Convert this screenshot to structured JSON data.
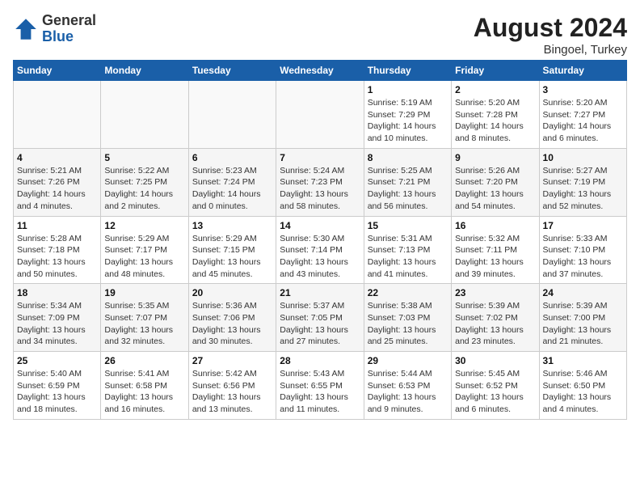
{
  "header": {
    "logo": {
      "general": "General",
      "blue": "Blue"
    },
    "title": "August 2024",
    "location": "Bingoel, Turkey"
  },
  "days_of_week": [
    "Sunday",
    "Monday",
    "Tuesday",
    "Wednesday",
    "Thursday",
    "Friday",
    "Saturday"
  ],
  "weeks": [
    [
      {
        "day": "",
        "info": ""
      },
      {
        "day": "",
        "info": ""
      },
      {
        "day": "",
        "info": ""
      },
      {
        "day": "",
        "info": ""
      },
      {
        "day": "1",
        "info": "Sunrise: 5:19 AM\nSunset: 7:29 PM\nDaylight: 14 hours\nand 10 minutes."
      },
      {
        "day": "2",
        "info": "Sunrise: 5:20 AM\nSunset: 7:28 PM\nDaylight: 14 hours\nand 8 minutes."
      },
      {
        "day": "3",
        "info": "Sunrise: 5:20 AM\nSunset: 7:27 PM\nDaylight: 14 hours\nand 6 minutes."
      }
    ],
    [
      {
        "day": "4",
        "info": "Sunrise: 5:21 AM\nSunset: 7:26 PM\nDaylight: 14 hours\nand 4 minutes."
      },
      {
        "day": "5",
        "info": "Sunrise: 5:22 AM\nSunset: 7:25 PM\nDaylight: 14 hours\nand 2 minutes."
      },
      {
        "day": "6",
        "info": "Sunrise: 5:23 AM\nSunset: 7:24 PM\nDaylight: 14 hours\nand 0 minutes."
      },
      {
        "day": "7",
        "info": "Sunrise: 5:24 AM\nSunset: 7:23 PM\nDaylight: 13 hours\nand 58 minutes."
      },
      {
        "day": "8",
        "info": "Sunrise: 5:25 AM\nSunset: 7:21 PM\nDaylight: 13 hours\nand 56 minutes."
      },
      {
        "day": "9",
        "info": "Sunrise: 5:26 AM\nSunset: 7:20 PM\nDaylight: 13 hours\nand 54 minutes."
      },
      {
        "day": "10",
        "info": "Sunrise: 5:27 AM\nSunset: 7:19 PM\nDaylight: 13 hours\nand 52 minutes."
      }
    ],
    [
      {
        "day": "11",
        "info": "Sunrise: 5:28 AM\nSunset: 7:18 PM\nDaylight: 13 hours\nand 50 minutes."
      },
      {
        "day": "12",
        "info": "Sunrise: 5:29 AM\nSunset: 7:17 PM\nDaylight: 13 hours\nand 48 minutes."
      },
      {
        "day": "13",
        "info": "Sunrise: 5:29 AM\nSunset: 7:15 PM\nDaylight: 13 hours\nand 45 minutes."
      },
      {
        "day": "14",
        "info": "Sunrise: 5:30 AM\nSunset: 7:14 PM\nDaylight: 13 hours\nand 43 minutes."
      },
      {
        "day": "15",
        "info": "Sunrise: 5:31 AM\nSunset: 7:13 PM\nDaylight: 13 hours\nand 41 minutes."
      },
      {
        "day": "16",
        "info": "Sunrise: 5:32 AM\nSunset: 7:11 PM\nDaylight: 13 hours\nand 39 minutes."
      },
      {
        "day": "17",
        "info": "Sunrise: 5:33 AM\nSunset: 7:10 PM\nDaylight: 13 hours\nand 37 minutes."
      }
    ],
    [
      {
        "day": "18",
        "info": "Sunrise: 5:34 AM\nSunset: 7:09 PM\nDaylight: 13 hours\nand 34 minutes."
      },
      {
        "day": "19",
        "info": "Sunrise: 5:35 AM\nSunset: 7:07 PM\nDaylight: 13 hours\nand 32 minutes."
      },
      {
        "day": "20",
        "info": "Sunrise: 5:36 AM\nSunset: 7:06 PM\nDaylight: 13 hours\nand 30 minutes."
      },
      {
        "day": "21",
        "info": "Sunrise: 5:37 AM\nSunset: 7:05 PM\nDaylight: 13 hours\nand 27 minutes."
      },
      {
        "day": "22",
        "info": "Sunrise: 5:38 AM\nSunset: 7:03 PM\nDaylight: 13 hours\nand 25 minutes."
      },
      {
        "day": "23",
        "info": "Sunrise: 5:39 AM\nSunset: 7:02 PM\nDaylight: 13 hours\nand 23 minutes."
      },
      {
        "day": "24",
        "info": "Sunrise: 5:39 AM\nSunset: 7:00 PM\nDaylight: 13 hours\nand 21 minutes."
      }
    ],
    [
      {
        "day": "25",
        "info": "Sunrise: 5:40 AM\nSunset: 6:59 PM\nDaylight: 13 hours\nand 18 minutes."
      },
      {
        "day": "26",
        "info": "Sunrise: 5:41 AM\nSunset: 6:58 PM\nDaylight: 13 hours\nand 16 minutes."
      },
      {
        "day": "27",
        "info": "Sunrise: 5:42 AM\nSunset: 6:56 PM\nDaylight: 13 hours\nand 13 minutes."
      },
      {
        "day": "28",
        "info": "Sunrise: 5:43 AM\nSunset: 6:55 PM\nDaylight: 13 hours\nand 11 minutes."
      },
      {
        "day": "29",
        "info": "Sunrise: 5:44 AM\nSunset: 6:53 PM\nDaylight: 13 hours\nand 9 minutes."
      },
      {
        "day": "30",
        "info": "Sunrise: 5:45 AM\nSunset: 6:52 PM\nDaylight: 13 hours\nand 6 minutes."
      },
      {
        "day": "31",
        "info": "Sunrise: 5:46 AM\nSunset: 6:50 PM\nDaylight: 13 hours\nand 4 minutes."
      }
    ]
  ]
}
